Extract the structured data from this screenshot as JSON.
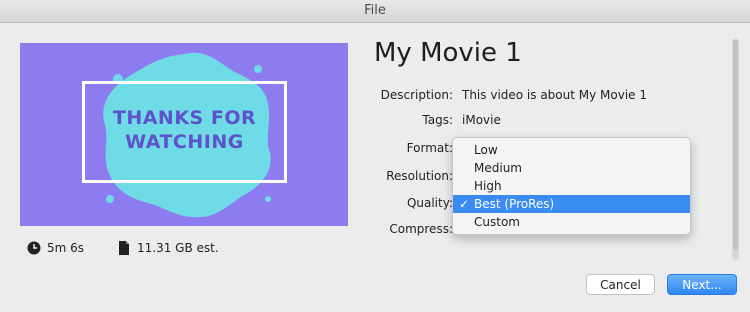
{
  "window": {
    "title": "File"
  },
  "preview": {
    "line1": "THANKS FOR",
    "line2": "WATCHING"
  },
  "meta": {
    "duration": "5m 6s",
    "size": "11.31 GB est."
  },
  "movie_title": "My Movie 1",
  "fields": {
    "description_label": "Description:",
    "description_value": "This video is about My Movie 1",
    "tags_label": "Tags:",
    "tags_value": "iMovie",
    "format_label": "Format:",
    "resolution_label": "Resolution:",
    "quality_label": "Quality:",
    "compress_label": "Compress:"
  },
  "quality_menu": {
    "options": [
      "Low",
      "Medium",
      "High",
      "Best (ProRes)",
      "Custom"
    ],
    "selected": "Best (ProRes)",
    "check": "✓"
  },
  "buttons": {
    "cancel": "Cancel",
    "next": "Next..."
  },
  "colors": {
    "accent": "#3a8bf2",
    "preview_bg": "#8d7cf0",
    "splash": "#6fdbe6",
    "frame_text": "#5d52cc"
  }
}
